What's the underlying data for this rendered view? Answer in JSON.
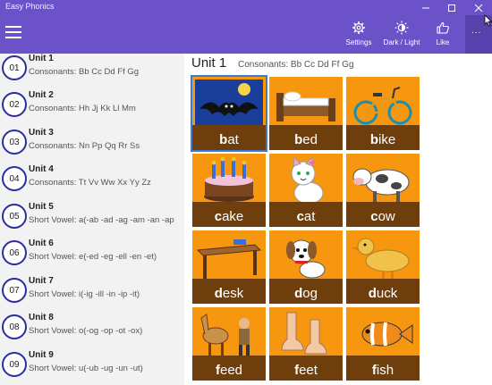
{
  "window": {
    "title": "Easy Phonics"
  },
  "commands": {
    "settings": "Settings",
    "theme": "Dark / Light",
    "like": "Like",
    "more": "..."
  },
  "units": [
    {
      "num": "01",
      "title": "Unit 1",
      "sub": "Consonants: Bb Cc Dd Ff Gg"
    },
    {
      "num": "02",
      "title": "Unit 2",
      "sub": "Consonants: Hh Jj Kk Ll Mm"
    },
    {
      "num": "03",
      "title": "Unit 3",
      "sub": "Consonants: Nn Pp Qq Rr Ss"
    },
    {
      "num": "04",
      "title": "Unit 4",
      "sub": "Consonants: Tt Vv Ww Xx Yy Zz"
    },
    {
      "num": "05",
      "title": "Unit 5",
      "sub": "Short Vowel: a(-ab -ad -ag -am -an -ap"
    },
    {
      "num": "06",
      "title": "Unit 6",
      "sub": "Short Vowel: e(-ed -eg -ell -en -et)"
    },
    {
      "num": "07",
      "title": "Unit 7",
      "sub": "Short Vowel: i(-ig -ill -in -ip -it)"
    },
    {
      "num": "08",
      "title": "Unit 8",
      "sub": "Short Vowel: o(-og -op -ot -ox)"
    },
    {
      "num": "09",
      "title": "Unit 9",
      "sub": "Short Vowel: u(-ub -ug -un -ut)"
    }
  ],
  "main": {
    "title": "Unit 1",
    "subtitle": "Consonants: Bb Cc Dd Ff Gg",
    "words": [
      {
        "first": "b",
        "rest": "at",
        "icon": "bat-picture"
      },
      {
        "first": "b",
        "rest": "ed",
        "icon": "bed-picture"
      },
      {
        "first": "b",
        "rest": "ike",
        "icon": "bike-picture"
      },
      {
        "first": "c",
        "rest": "ake",
        "icon": "cake-picture"
      },
      {
        "first": "c",
        "rest": "at",
        "icon": "cat-picture"
      },
      {
        "first": "c",
        "rest": "ow",
        "icon": "cow-picture"
      },
      {
        "first": "d",
        "rest": "esk",
        "icon": "desk-picture"
      },
      {
        "first": "d",
        "rest": "og",
        "icon": "dog-picture"
      },
      {
        "first": "d",
        "rest": "uck",
        "icon": "duck-picture"
      },
      {
        "first": "f",
        "rest": "eed",
        "icon": "feed-picture"
      },
      {
        "first": "f",
        "rest": "eet",
        "icon": "feet-picture"
      },
      {
        "first": "f",
        "rest": "ish",
        "icon": "fish-picture"
      }
    ]
  },
  "colors": {
    "accent": "#6b52c9",
    "tile": "#f7960f",
    "tile_bar": "#6e3e0d",
    "badge_ring": "#2a2fa0"
  }
}
